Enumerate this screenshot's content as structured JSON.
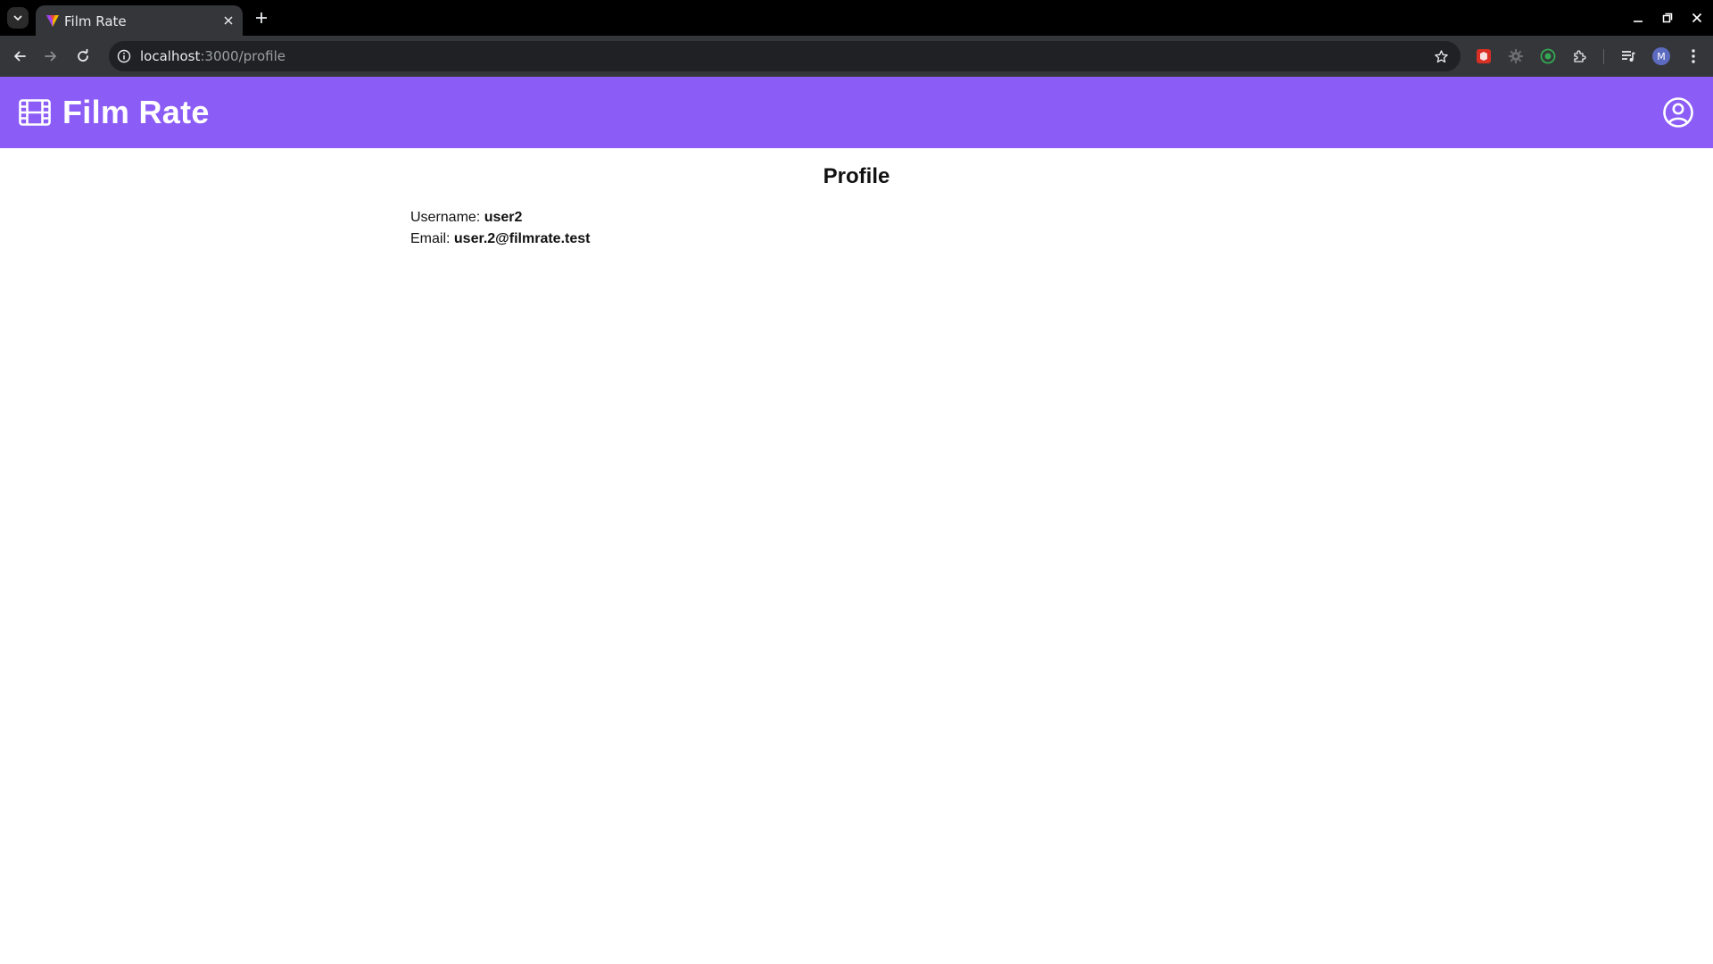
{
  "browser": {
    "tab_title": "Film Rate",
    "url_host": "localhost",
    "url_rest": ":3000/profile",
    "profile_initial": "M"
  },
  "header": {
    "title": "Film Rate",
    "brand_color": "#8b5cf6",
    "brand_icon": "film-icon",
    "account_icon": "account-circle-icon"
  },
  "profile": {
    "heading": "Profile",
    "username_label": "Username: ",
    "username": "user2",
    "email_label": "Email: ",
    "email": "user.2@filmrate.test"
  }
}
